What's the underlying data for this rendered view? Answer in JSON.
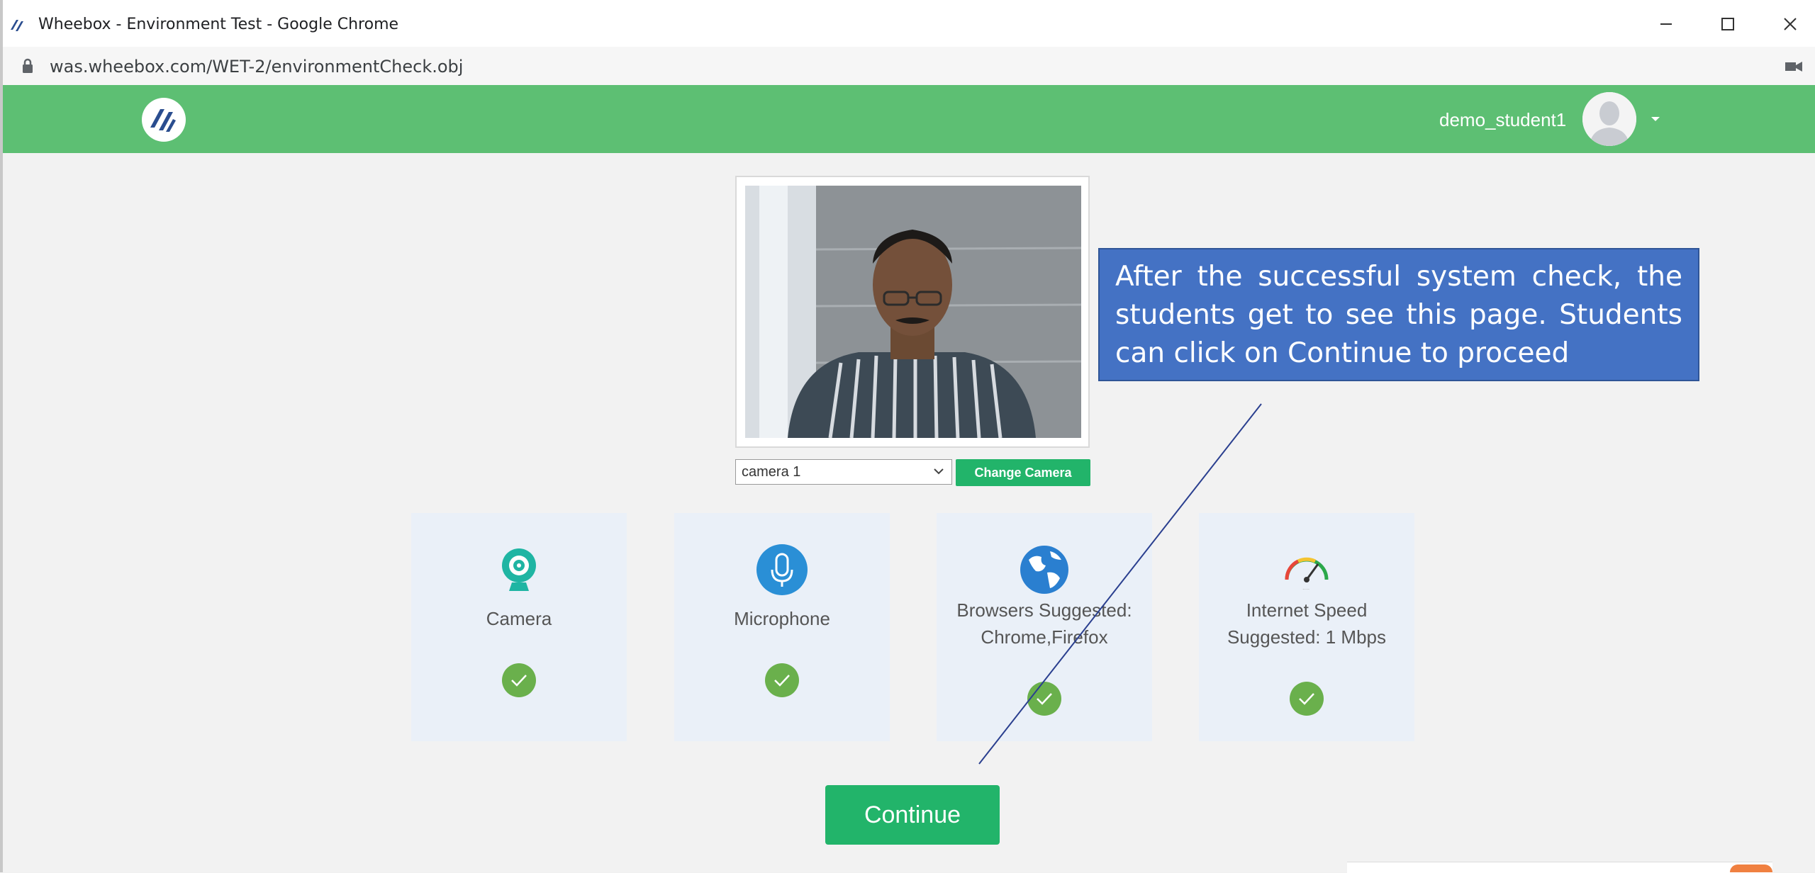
{
  "window": {
    "title": "Wheebox - Environment Test - Google Chrome",
    "url": "was.wheebox.com/WET-2/environmentCheck.obj"
  },
  "header": {
    "user_name": "demo_student1",
    "brand_color": "#5dbf73"
  },
  "camera": {
    "selected": "camera 1",
    "change_label": "Change Camera"
  },
  "checks": [
    {
      "label": "Camera",
      "icon": "webcam-icon",
      "status": "passed"
    },
    {
      "label": "Microphone",
      "icon": "microphone-icon",
      "status": "passed"
    },
    {
      "label": "Browsers Suggested: Chrome,Firefox",
      "icon": "globe-icon",
      "status": "passed"
    },
    {
      "label": "Internet Speed Suggested: 1 Mbps",
      "icon": "speedometer-icon",
      "status": "passed"
    }
  ],
  "continue_label": "Continue",
  "annotation": {
    "text": "After the successful system check, the students get to see this page. Students can click on Continue to proceed"
  },
  "colors": {
    "accent_green": "#22b46a",
    "check_green": "#6ab04c",
    "card_bg": "#eaf0f8",
    "callout_blue": "#4472c4"
  }
}
